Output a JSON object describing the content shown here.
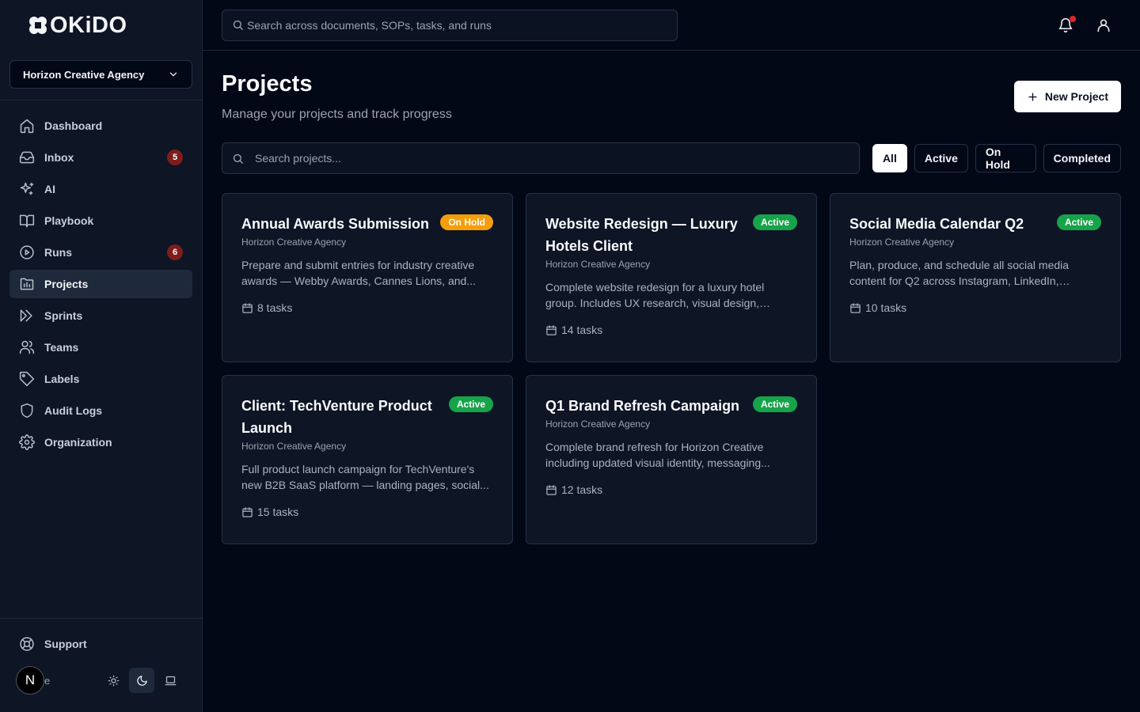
{
  "app": {
    "logo_text": "OKiDO"
  },
  "sidebar": {
    "org_name": "Horizon Creative Agency",
    "items": [
      {
        "label": "Dashboard",
        "icon": "home-icon"
      },
      {
        "label": "Inbox",
        "icon": "inbox-icon",
        "badge": "5"
      },
      {
        "label": "AI",
        "icon": "sparkles-icon"
      },
      {
        "label": "Playbook",
        "icon": "book-icon"
      },
      {
        "label": "Runs",
        "icon": "play-circle-icon",
        "badge": "6"
      },
      {
        "label": "Projects",
        "icon": "folder-icon",
        "active": true
      },
      {
        "label": "Sprints",
        "icon": "sprint-icon"
      },
      {
        "label": "Teams",
        "icon": "users-icon"
      },
      {
        "label": "Labels",
        "icon": "tag-icon"
      },
      {
        "label": "Audit Logs",
        "icon": "shield-icon"
      },
      {
        "label": "Organization",
        "icon": "gear-icon"
      }
    ],
    "support_label": "Support",
    "user": {
      "initial": "N",
      "name": "e"
    }
  },
  "topbar": {
    "search_placeholder": "Search across documents, SOPs, tasks, and runs"
  },
  "main": {
    "title": "Projects",
    "subtitle": "Manage your projects and track progress",
    "new_button_label": "New Project",
    "search_placeholder": "Search projects...",
    "filters": [
      "All",
      "Active",
      "On Hold",
      "Completed"
    ],
    "active_filter": "All",
    "projects": [
      {
        "title": "Annual Awards Submission",
        "status": "On Hold",
        "org": "Horizon Creative Agency",
        "description": "Prepare and submit entries for industry creative awards — Webby Awards, Cannes Lions, and...",
        "tasks": "8 tasks"
      },
      {
        "title": "Website Redesign — Luxury Hotels Client",
        "status": "Active",
        "org": "Horizon Creative Agency",
        "description": "Complete website redesign for a luxury hotel group. Includes UX research, visual design, conte...",
        "tasks": "14 tasks"
      },
      {
        "title": "Social Media Calendar Q2",
        "status": "Active",
        "org": "Horizon Creative Agency",
        "description": "Plan, produce, and schedule all social media content for Q2 across Instagram, LinkedIn, TikTok,...",
        "tasks": "10 tasks"
      },
      {
        "title": "Client: TechVenture Product Launch",
        "status": "Active",
        "org": "Horizon Creative Agency",
        "description": "Full product launch campaign for TechVenture's new B2B SaaS platform — landing pages, social...",
        "tasks": "15 tasks"
      },
      {
        "title": "Q1 Brand Refresh Campaign",
        "status": "Active",
        "org": "Horizon Creative Agency",
        "description": "Complete brand refresh for Horizon Creative including updated visual identity, messaging...",
        "tasks": "12 tasks"
      }
    ]
  },
  "colors": {
    "background": "#030817",
    "sidebar": "#0e1525",
    "active_badge": "#16a34a",
    "onhold_badge": "#f59e0b",
    "count_badge": "#7f1d1d",
    "notification_dot": "#dc2626"
  }
}
